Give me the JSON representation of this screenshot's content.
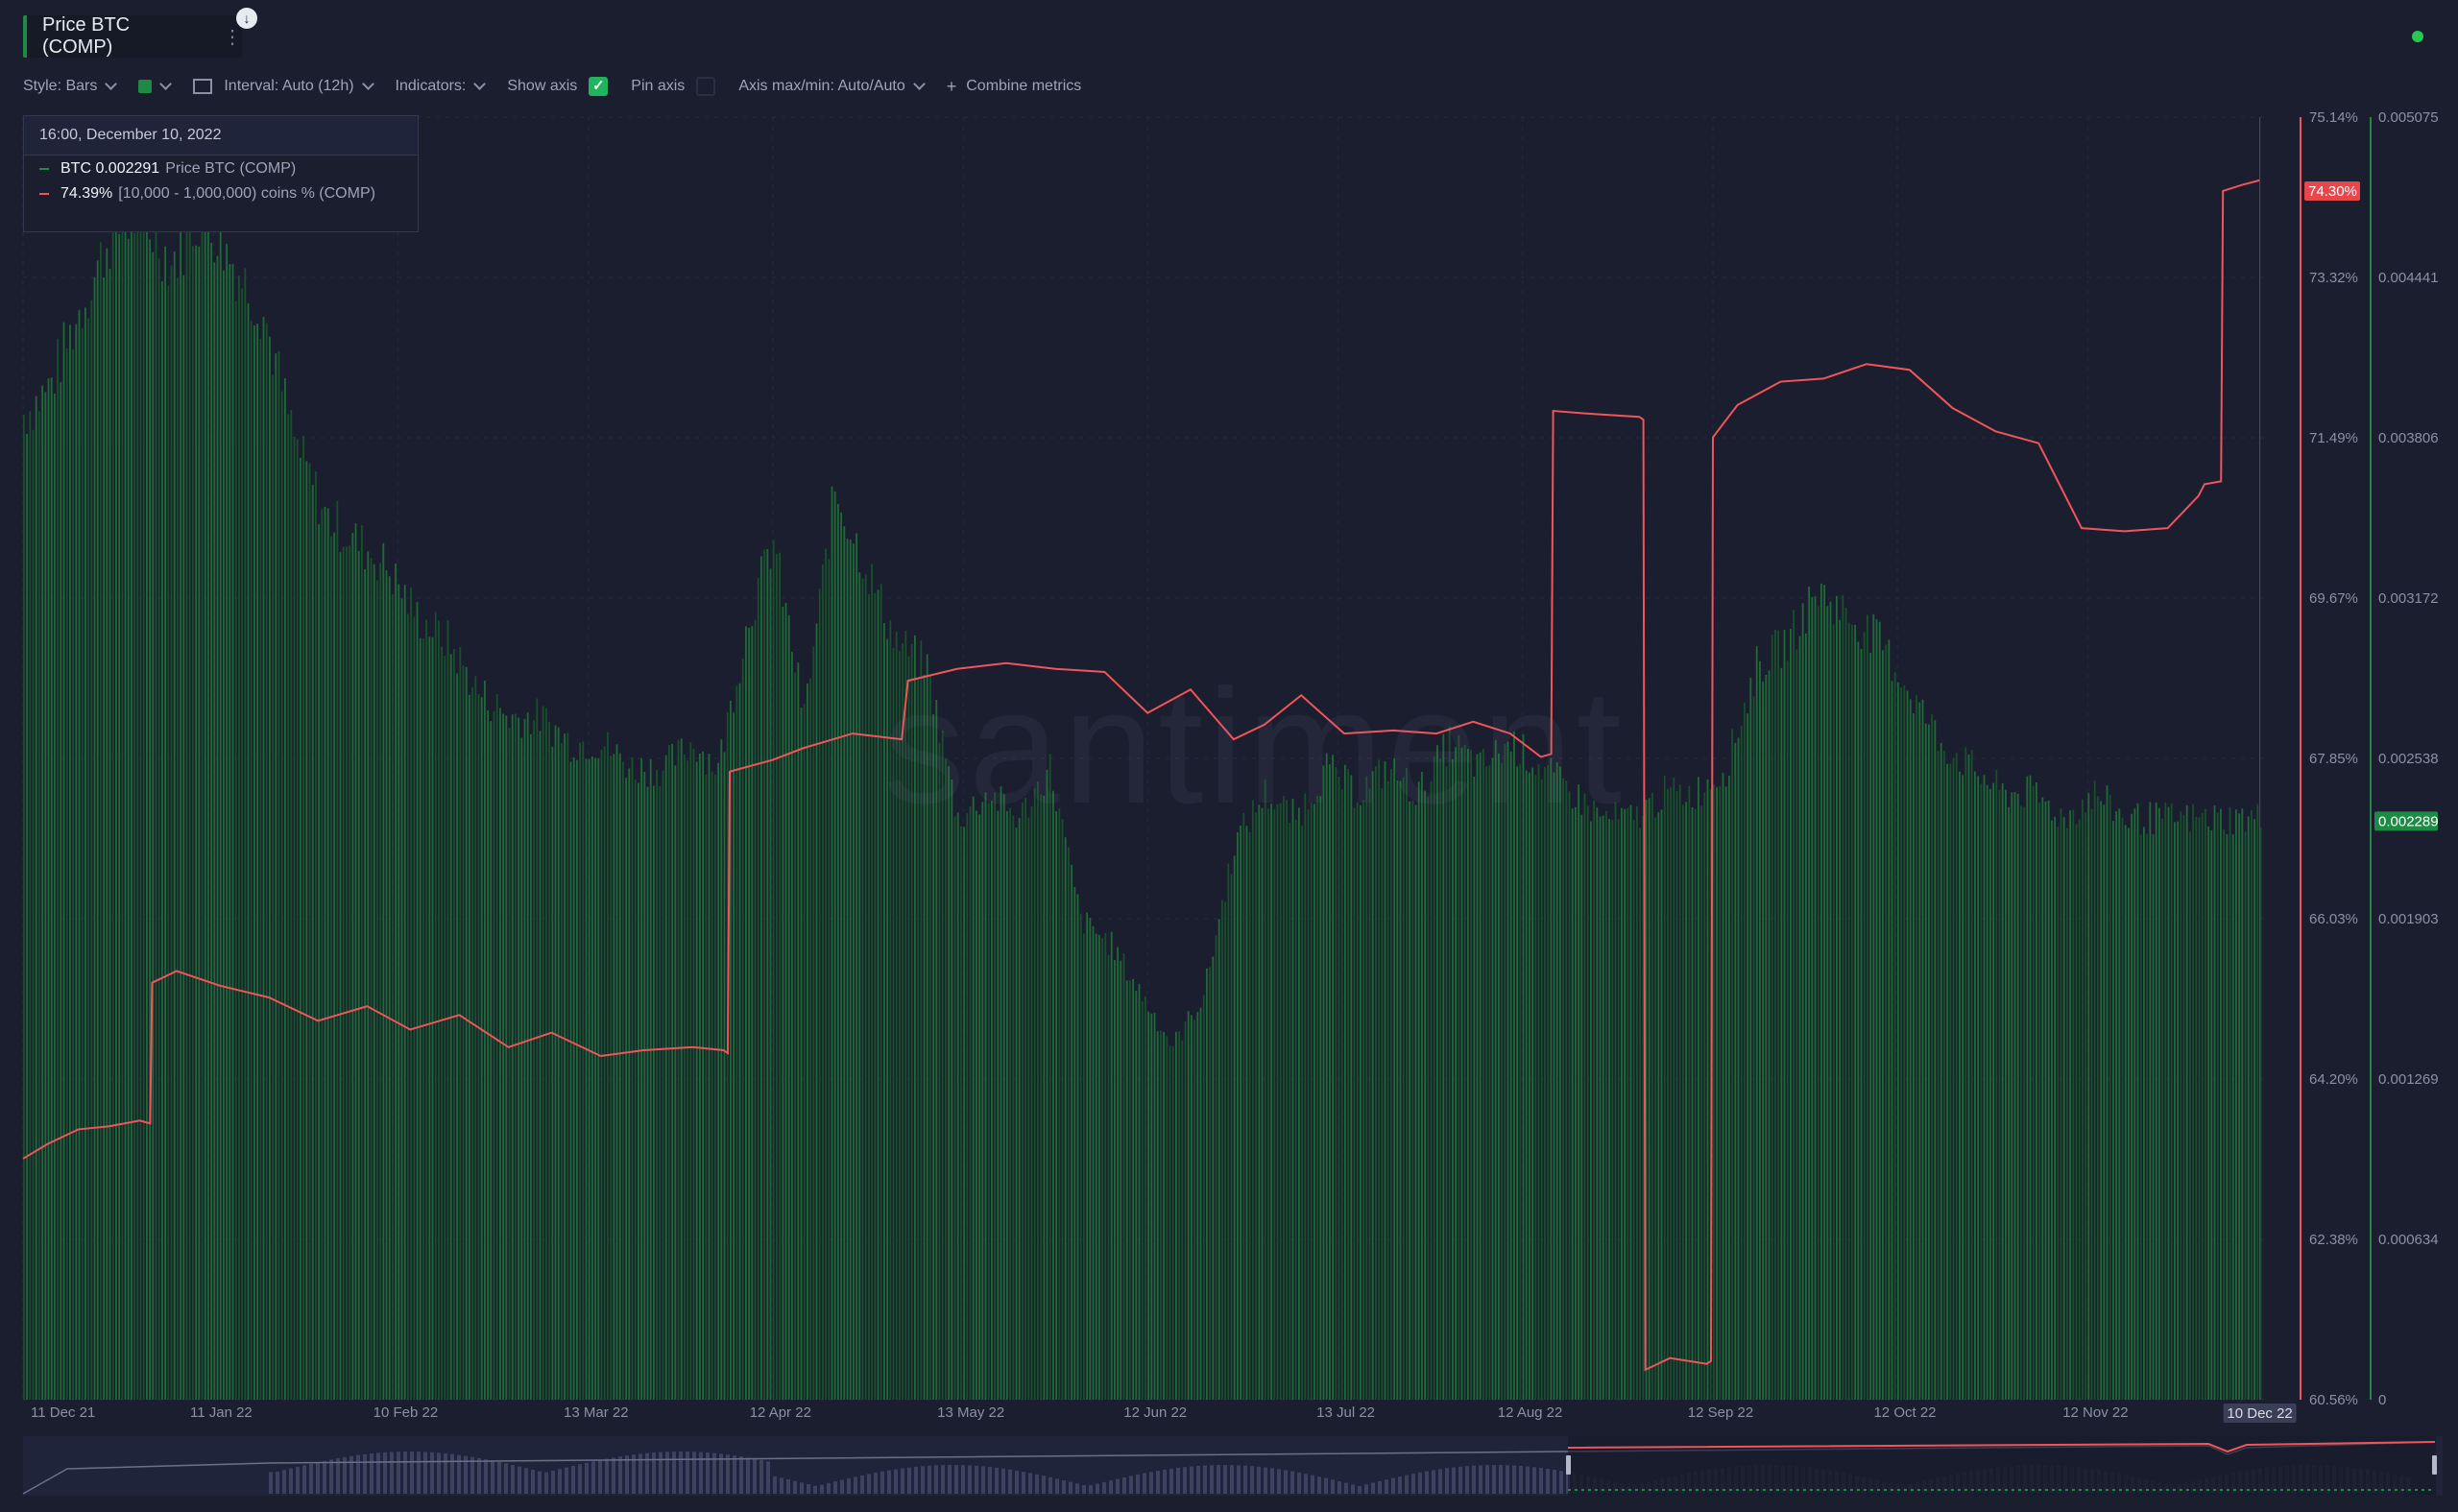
{
  "header": {
    "metric_tab": "Price BTC (COMP)",
    "menu_dots": "⋮",
    "pin_icon": "↓"
  },
  "controls": {
    "style": "Style: Bars",
    "interval": "Interval: Auto (12h)",
    "indicators": "Indicators:",
    "show_axis": "Show axis",
    "show_axis_checked": true,
    "pin_axis": "Pin axis",
    "pin_axis_checked": false,
    "axis_maxmin": "Axis max/min: Auto/Auto",
    "combine": "Combine metrics"
  },
  "tooltip": {
    "date": "16:00, December 10, 2022",
    "rows": [
      {
        "value": "BTC 0.002291",
        "name": "Price BTC (COMP)",
        "color": "#1f8a43"
      },
      {
        "value": "74.39%",
        "name": "[10,000 - 1,000,000) coins % (COMP)",
        "color": "#f0555a"
      }
    ]
  },
  "watermark": "santiment",
  "colors": {
    "bars": "#17502a",
    "bars_top": "#1f6b37",
    "line": "#f0555a",
    "background": "#1b1e2f",
    "grid": "#262a3d",
    "axis_text": "#8b90a5"
  },
  "chart_data": {
    "type": "bar+line",
    "x_ticks": [
      "11 Dec 21",
      "11 Jan 22",
      "10 Feb 22",
      "13 Mar 22",
      "12 Apr 22",
      "13 May 22",
      "12 Jun 22",
      "13 Jul 22",
      "12 Aug 22",
      "12 Sep 22",
      "12 Oct 22",
      "12 Nov 22",
      "10 Dec 22"
    ],
    "x_hover_label": "10 Dec 22",
    "left_axis": {
      "name": "[10,000 - 1,000,000) coins % (COMP)",
      "ticks": [
        "75.14%",
        "73.32%",
        "71.49%",
        "69.67%",
        "67.85%",
        "66.03%",
        "64.20%",
        "62.38%",
        "60.56%"
      ],
      "ylim": [
        60.56,
        75.14
      ],
      "current_label": "74.30%"
    },
    "right_axis": {
      "name": "Price BTC (COMP)",
      "ticks": [
        "0.005075",
        "0.004441",
        "0.003806",
        "0.003172",
        "0.002538",
        "0.001903",
        "0.001269",
        "0.000634",
        "0"
      ],
      "ylim": [
        0,
        0.005075
      ],
      "current_label": "0.002289"
    },
    "series": [
      {
        "name": "Price BTC (COMP)",
        "kind": "bar",
        "x": [
          "2021-12-11",
          "2021-12-15",
          "2021-12-20",
          "2021-12-25",
          "2021-12-30",
          "2022-01-04",
          "2022-01-09",
          "2022-01-14",
          "2022-01-19",
          "2022-01-24",
          "2022-01-29",
          "2022-02-03",
          "2022-02-08",
          "2022-02-13",
          "2022-02-18",
          "2022-02-23",
          "2022-02-28",
          "2022-03-05",
          "2022-03-10",
          "2022-03-15",
          "2022-03-20",
          "2022-03-25",
          "2022-03-30",
          "2022-04-03",
          "2022-04-08",
          "2022-04-12",
          "2022-04-17",
          "2022-04-22",
          "2022-04-27",
          "2022-05-02",
          "2022-05-07",
          "2022-05-12",
          "2022-05-17",
          "2022-05-22",
          "2022-05-27",
          "2022-06-01",
          "2022-06-06",
          "2022-06-11",
          "2022-06-16",
          "2022-06-21",
          "2022-06-26",
          "2022-07-01",
          "2022-07-06",
          "2022-07-11",
          "2022-07-16",
          "2022-07-21",
          "2022-07-26",
          "2022-07-31",
          "2022-08-05",
          "2022-08-10",
          "2022-08-15",
          "2022-08-20",
          "2022-08-25",
          "2022-08-30",
          "2022-09-04",
          "2022-09-09",
          "2022-09-14",
          "2022-09-19",
          "2022-09-24",
          "2022-09-29",
          "2022-10-04",
          "2022-10-09",
          "2022-10-14",
          "2022-10-19",
          "2022-10-24",
          "2022-10-29",
          "2022-11-03",
          "2022-11-08",
          "2022-11-13",
          "2022-11-18",
          "2022-11-23",
          "2022-11-28",
          "2022-12-03",
          "2022-12-07",
          "2022-12-10"
        ],
        "values": [
          0.0039,
          0.004,
          0.0043,
          0.0046,
          0.0047,
          0.0045,
          0.0047,
          0.0045,
          0.0043,
          0.0038,
          0.0035,
          0.0034,
          0.0033,
          0.0031,
          0.003,
          0.0028,
          0.0027,
          0.0027,
          0.0026,
          0.0026,
          0.0025,
          0.0025,
          0.0026,
          0.0025,
          0.0031,
          0.0034,
          0.0027,
          0.0036,
          0.0033,
          0.003,
          0.0029,
          0.0023,
          0.0024,
          0.0023,
          0.0025,
          0.0019,
          0.0018,
          0.0016,
          0.0014,
          0.0016,
          0.0022,
          0.0024,
          0.0023,
          0.0025,
          0.0024,
          0.0025,
          0.0024,
          0.0026,
          0.0025,
          0.0026,
          0.0025,
          0.0024,
          0.0023,
          0.0023,
          0.0024,
          0.0024,
          0.0025,
          0.0029,
          0.003,
          0.0032,
          0.0031,
          0.003,
          0.0028,
          0.0026,
          0.0025,
          0.0024,
          0.0024,
          0.0023,
          0.0024,
          0.0023,
          0.0023,
          0.0023,
          0.0023,
          0.0023,
          0.0023
        ]
      },
      {
        "name": "[10,000 - 1,000,000) coins % (COMP)",
        "kind": "line",
        "x": [
          "2021-12-11",
          "2021-12-15",
          "2021-12-20",
          "2021-12-25",
          "2021-12-30",
          "2022-01-01",
          "2022-01-05",
          "2022-01-12",
          "2022-01-20",
          "2022-01-28",
          "2022-02-05",
          "2022-02-12",
          "2022-02-20",
          "2022-02-28",
          "2022-03-07",
          "2022-03-15",
          "2022-03-22",
          "2022-03-30",
          "2022-04-04",
          "2022-04-05",
          "2022-04-12",
          "2022-04-17",
          "2022-04-25",
          "2022-05-03",
          "2022-05-04",
          "2022-05-12",
          "2022-05-20",
          "2022-05-28",
          "2022-06-05",
          "2022-06-12",
          "2022-06-19",
          "2022-06-26",
          "2022-07-01",
          "2022-07-07",
          "2022-07-14",
          "2022-07-22",
          "2022-07-29",
          "2022-08-04",
          "2022-08-10",
          "2022-08-15",
          "2022-08-17",
          "2022-08-23",
          "2022-08-31",
          "2022-09-01",
          "2022-09-05",
          "2022-09-11",
          "2022-09-12",
          "2022-09-16",
          "2022-09-23",
          "2022-09-30",
          "2022-10-07",
          "2022-10-14",
          "2022-10-21",
          "2022-10-28",
          "2022-11-04",
          "2022-11-11",
          "2022-11-18",
          "2022-11-25",
          "2022-11-30",
          "2022-12-01",
          "2022-12-04",
          "2022-12-07",
          "2022-12-10"
        ],
        "values": [
          63.3,
          63.5,
          63.6,
          63.7,
          63.7,
          65.3,
          65.4,
          65.3,
          65.1,
          64.9,
          65.0,
          64.8,
          64.9,
          64.6,
          64.7,
          64.5,
          64.5,
          64.6,
          64.5,
          67.7,
          67.8,
          68.0,
          68.1,
          68.1,
          68.7,
          68.9,
          68.9,
          68.9,
          68.8,
          68.4,
          68.6,
          68.1,
          68.2,
          68.6,
          68.1,
          68.2,
          68.1,
          68.3,
          68.1,
          67.9,
          71.8,
          71.8,
          71.7,
          60.9,
          61.0,
          61.0,
          71.5,
          71.9,
          72.1,
          72.2,
          72.3,
          72.3,
          71.8,
          71.6,
          71.4,
          70.5,
          70.4,
          70.5,
          70.8,
          71.0,
          74.3,
          74.4,
          74.39
        ]
      }
    ],
    "navigator": true,
    "grid": true,
    "legend": "tooltip top-left"
  }
}
